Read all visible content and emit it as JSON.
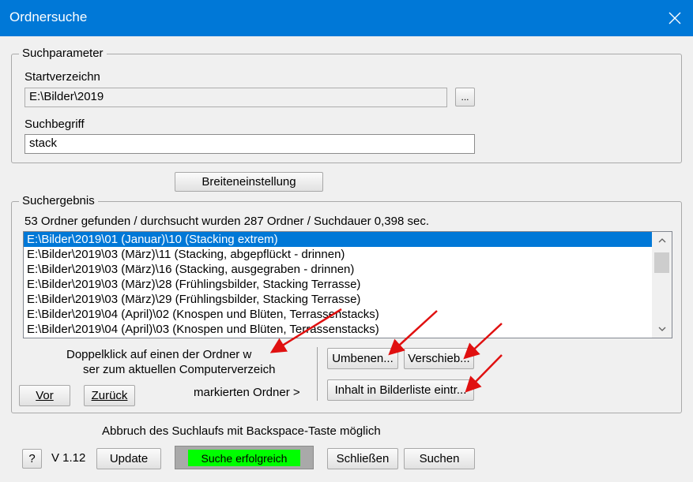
{
  "window": {
    "title": "Ordnersuche",
    "close_icon": "close-icon"
  },
  "params": {
    "group_label": "Suchparameter",
    "start_dir_label": "Startverzeichn",
    "start_dir_value": "E:\\Bilder\\2019",
    "browse_label": "...",
    "term_label": "Suchbegriff",
    "term_value": "stack"
  },
  "width_button": "Breiteneinstellung",
  "results": {
    "group_label": "Suchergebnis",
    "summary": "53 Ordner gefunden / durchsucht wurden 287 Ordner / Suchdauer 0,398 sec.",
    "items": [
      "E:\\Bilder\\2019\\01 (Januar)\\10 (Stacking extrem)",
      "E:\\Bilder\\2019\\03 (März)\\11 (Stacking, abgepflückt - drinnen)",
      "E:\\Bilder\\2019\\03 (März)\\16 (Stacking, ausgegraben - drinnen)",
      "E:\\Bilder\\2019\\03 (März)\\28 (Frühlingsbilder, Stacking Terrasse)",
      "E:\\Bilder\\2019\\03 (März)\\29 (Frühlingsbilder, Stacking Terrasse)",
      "E:\\Bilder\\2019\\04 (April)\\02 (Knospen und Blüten, Terrassenstacks)",
      "E:\\Bilder\\2019\\04 (April)\\03 (Knospen und Blüten, Terrassenstacks)"
    ],
    "selected_index": 0,
    "hint_line1": "Doppelklick auf einen der Ordner w",
    "hint_line2": "ser zum aktuellen Computerverzeich",
    "marked_label": "markierten Ordner >",
    "rename_button": "Umbenen...",
    "move_button": "Verschieb...",
    "add_to_list_button": "Inhalt in Bilderliste eintr...",
    "forward_button": "Vor",
    "back_button": "Zurück"
  },
  "footer": {
    "abort_hint": "Abbruch des Suchlaufs mit Backspace-Taste möglich",
    "help_button": "?",
    "version": "V 1.12",
    "update_button": "Update",
    "status_text": "Suche erfolgreich",
    "close_button": "Schließen",
    "search_button": "Suchen"
  },
  "colors": {
    "titlebar": "#0078d7",
    "selection": "#0078d7",
    "status_ok": "#00ff00",
    "annotation_arrow": "#e01010"
  }
}
